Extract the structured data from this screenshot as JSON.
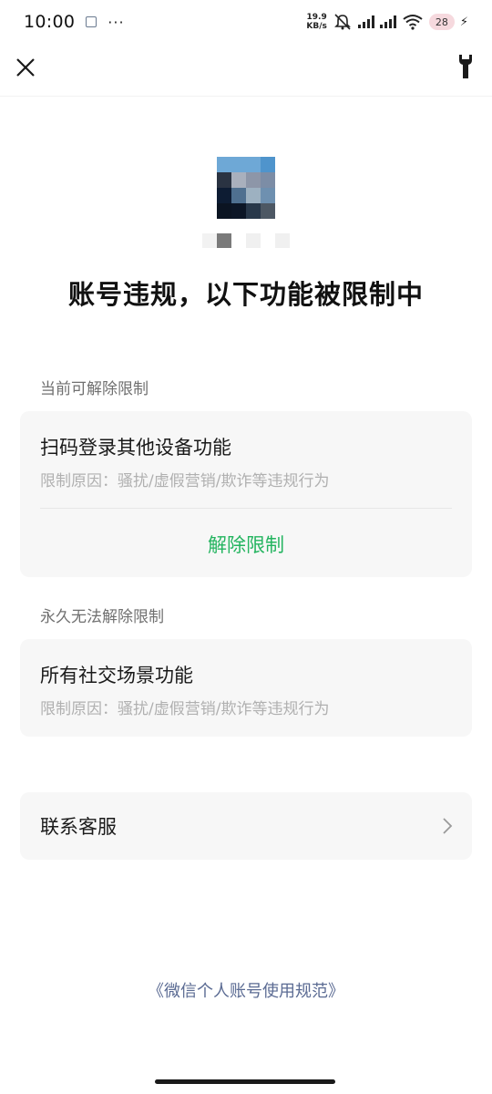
{
  "status_bar": {
    "time": "10:00",
    "more": "···",
    "speed_value": "19.9",
    "speed_unit": "KB/s",
    "battery": "28"
  },
  "nav": {
    "close_icon": "close-icon",
    "tool_icon": "wrench-icon"
  },
  "header": {
    "title": "账号违规，以下功能被限制中"
  },
  "removable": {
    "section_label": "当前可解除限制",
    "feature": "扫码登录其他设备功能",
    "reason": "限制原因：骚扰/虚假营销/欺诈等违规行为",
    "action": "解除限制"
  },
  "permanent": {
    "section_label": "永久无法解除限制",
    "feature": "所有社交场景功能",
    "reason": "限制原因：骚扰/虚假营销/欺诈等违规行为"
  },
  "service": {
    "label": "联系客服"
  },
  "footer": {
    "policy_link": "《微信个人账号使用规范》"
  },
  "colors": {
    "accent_green": "#23b45f",
    "link_blue": "#5b6b93",
    "card_bg": "#f7f7f7"
  }
}
